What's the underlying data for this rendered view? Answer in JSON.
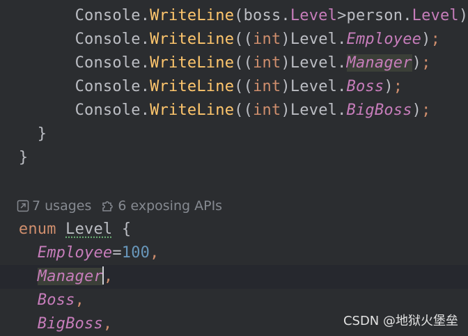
{
  "code": {
    "console": "Console",
    "dot": ".",
    "writeline": "WriteLine",
    "lparen": "(",
    "rparen": ")",
    "semi": ";",
    "int_kw": "int",
    "level": "Level",
    "line1": {
      "boss": "boss",
      "level_field": "Level",
      "gt": ">",
      "person": "person"
    },
    "line2_member": "Employee",
    "line3_member": "Manager",
    "line4_member": "Boss",
    "line5_member": "BigBoss",
    "brace_close": "}",
    "enum_kw": "enum",
    "brace_open": "{",
    "enum_members": {
      "employee": "Employee",
      "eq": "=",
      "employee_value": "100",
      "manager": "Manager",
      "boss": "Boss",
      "bigboss": "BigBoss",
      "comma": ","
    }
  },
  "hints": {
    "usages": "7 usages",
    "exposing": "6 exposing APIs"
  },
  "watermark": "CSDN @地狱火堡垒",
  "colors": {
    "background": "#2b2d30",
    "method": "#ffc66d",
    "keyword": "#cf8e6d",
    "field": "#c77dbb",
    "number": "#6897bb"
  }
}
